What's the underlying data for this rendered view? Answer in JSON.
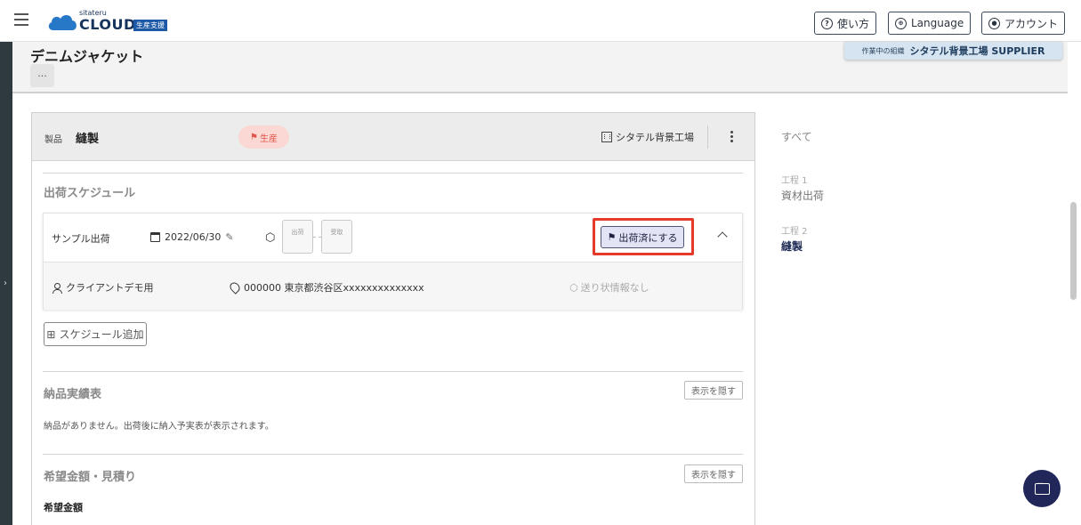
{
  "header": {
    "logo_small": "sitateru",
    "logo_big": "CLOUD",
    "logo_badge": "生産支援",
    "help_label": "使い方",
    "language_label": "Language",
    "account_label": "アカウント"
  },
  "page": {
    "title": "デニムジャケット",
    "more_label": "···",
    "org_label": "作業中の組織",
    "org_name": "シタテル背景工場 SUPPLIER"
  },
  "card": {
    "product_label": "製品",
    "process_name": "縫製",
    "status_tag": "生産",
    "factory": "シタテル背景工場"
  },
  "shipping": {
    "section_title": "出荷スケジュール",
    "schedule_label": "サンプル出荷",
    "date": "2022/06/30",
    "step_ship": "出荷",
    "step_receive": "受取",
    "ship_button": "出荷済にする",
    "recipient": "クライアントデモ用",
    "address": "000000 東京都渋谷区xxxxxxxxxxxxxx",
    "no_shipping_info": "送り状情報なし",
    "add_schedule": "スケジュール追加"
  },
  "delivery": {
    "section_title": "納品実績表",
    "hide_label": "表示を隠す",
    "empty_message": "納品がありません。出荷後に納入予実表が表示されます。"
  },
  "estimate": {
    "section_title": "希望金額・見積り",
    "hide_label": "表示を隠す",
    "sub_label": "希望金額"
  },
  "sidebar": {
    "all_label": "すべて",
    "steps": [
      {
        "number": "工程 1",
        "label": "資材出荷"
      },
      {
        "number": "工程 2",
        "label": "縫製"
      }
    ]
  },
  "colors": {
    "accent": "#22275a",
    "highlight": "#e53a2a",
    "tag_bg": "#fbd8d3",
    "tag_text": "#e0564a"
  }
}
